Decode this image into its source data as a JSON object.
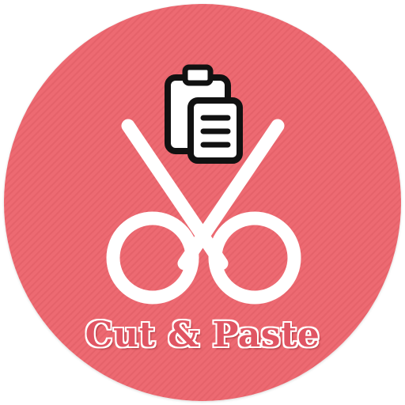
{
  "app": {
    "caption": "Cut & Paste"
  },
  "icons": {
    "main": "scissors-icon",
    "overlay": "clipboard-icon"
  },
  "colors": {
    "badge_background": "#ed6a72",
    "badge_stripe": "#e5626a",
    "glyph": "#ffffff",
    "clipboard_outline": "#111111",
    "caption_text": "#e05563"
  }
}
